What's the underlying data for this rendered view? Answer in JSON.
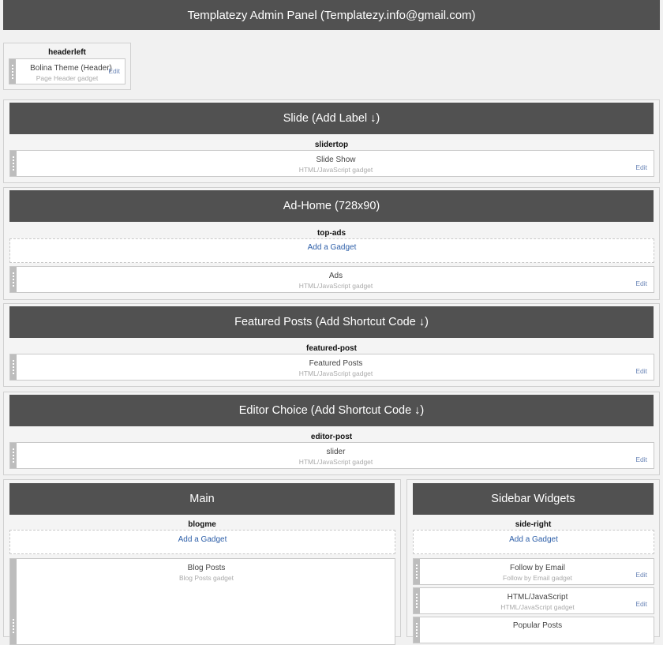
{
  "header": {
    "title": "Templatezy Admin Panel (Templatezy.info@gmail.com)"
  },
  "headerleft": {
    "label": "headerleft",
    "gadget": {
      "title": "Bolina Theme (Header)",
      "type": "Page Header gadget",
      "edit": "Edit"
    }
  },
  "slide": {
    "title": "Slide (Add Label",
    "arrow": "↓",
    "label": "slidertop",
    "gadget": {
      "title": "Slide Show",
      "type": "HTML/JavaScript gadget",
      "edit": "Edit"
    }
  },
  "adhome": {
    "title": "Ad-Home (728x90)",
    "label": "top-ads",
    "add_gadget": "Add a Gadget",
    "gadget": {
      "title": "Ads",
      "type": "HTML/JavaScript gadget",
      "edit": "Edit"
    }
  },
  "featured": {
    "title": "Featured Posts (Add Shortcut Code",
    "arrow": "↓",
    "label": "featured-post",
    "gadget": {
      "title": "Featured Posts",
      "type": "HTML/JavaScript gadget",
      "edit": "Edit"
    }
  },
  "editor": {
    "title": "Editor Choice (Add Shortcut Code",
    "arrow": "↓",
    "label": "editor-post",
    "gadget": {
      "title": "slider",
      "type": "HTML/JavaScript gadget",
      "edit": "Edit"
    }
  },
  "main": {
    "title": "Main",
    "label": "blogme",
    "add_gadget": "Add a Gadget",
    "gadget": {
      "title": "Blog Posts",
      "type": "Blog Posts gadget"
    }
  },
  "sidebar": {
    "title": "Sidebar Widgets",
    "label": "side-right",
    "add_gadget": "Add a Gadget",
    "gadgets": [
      {
        "title": "Follow by Email",
        "type": "Follow by Email gadget",
        "edit": "Edit"
      },
      {
        "title": "HTML/JavaScript",
        "type": "HTML/JavaScript gadget",
        "edit": "Edit"
      },
      {
        "title": "Popular Posts"
      }
    ]
  },
  "colors": {
    "bar": "#515151",
    "background": "#f1f1f1",
    "link": "#2c5ea8",
    "edit_link": "#6b86b7",
    "handle": "#bdbdbd"
  },
  "icons": {
    "drag_handle": "drag-handle-icon",
    "arrow": "arrow-down-icon"
  }
}
